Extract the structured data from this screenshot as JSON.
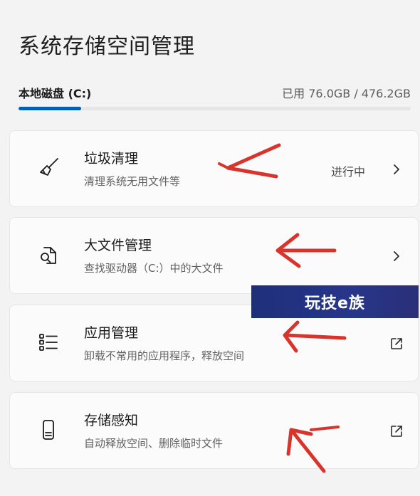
{
  "page": {
    "title": "系统存储空间管理"
  },
  "disk": {
    "name": "本地磁盘 (C:)",
    "usage": "已用 76.0GB / 476.2GB",
    "used_fraction": 0.16
  },
  "items": [
    {
      "label": "垃圾清理",
      "desc": "清理系统无用文件等",
      "status": "进行中",
      "icon": "broom-icon",
      "action": "chevron-right-icon"
    },
    {
      "label": "大文件管理",
      "desc": "查找驱动器（C:）中的大文件",
      "status": "",
      "icon": "file-search-icon",
      "action": "chevron-right-icon"
    },
    {
      "label": "应用管理",
      "desc": "卸载不常用的应用程序，释放空间",
      "status": "",
      "icon": "list-icon",
      "action": "external-link-icon"
    },
    {
      "label": "存储感知",
      "desc": "自动释放空间、删除临时文件",
      "status": "",
      "icon": "phone-storage-icon",
      "action": "external-link-icon"
    }
  ],
  "watermark": {
    "text": "玩技e族"
  },
  "colors": {
    "accent": "#005fb8",
    "annotation_arrow": "#d9342b",
    "watermark_bg": "#1e2f7a"
  }
}
